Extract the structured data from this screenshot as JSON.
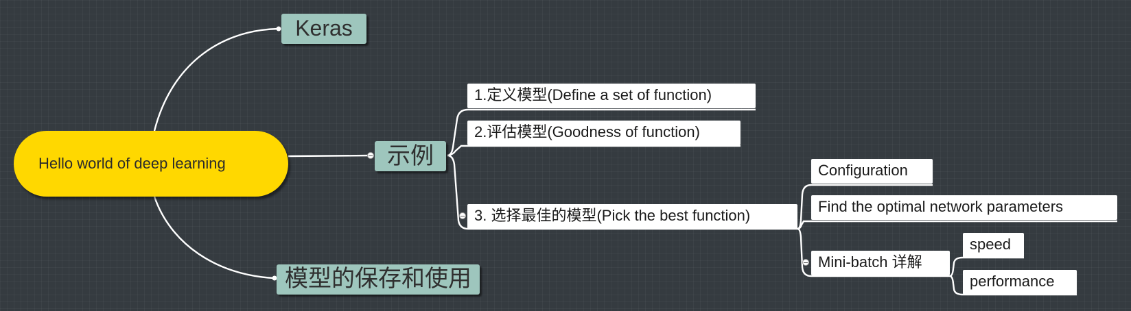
{
  "mindmap": {
    "root": "Hello world of deep learning",
    "topics": {
      "keras": "Keras",
      "example": "示例",
      "save_use": "模型的保存和使用"
    },
    "example_steps": {
      "define": "1.定义模型(Define a set of function)",
      "evaluate": "2.评估模型(Goodness of function)",
      "pick": "3. 选择最佳的模型(Pick the best function)"
    },
    "pick_children": {
      "configuration": "Configuration",
      "optimal": "Find the optimal network parameters",
      "minibatch": "Mini-batch 详解"
    },
    "minibatch_children": {
      "speed": "speed",
      "performance": "performance"
    }
  },
  "colors": {
    "background": "#353b40",
    "root_fill": "#ffd800",
    "topic_fill": "#9ec6bd",
    "subtopic_fill": "#ffffff",
    "connector": "#ffffff"
  }
}
